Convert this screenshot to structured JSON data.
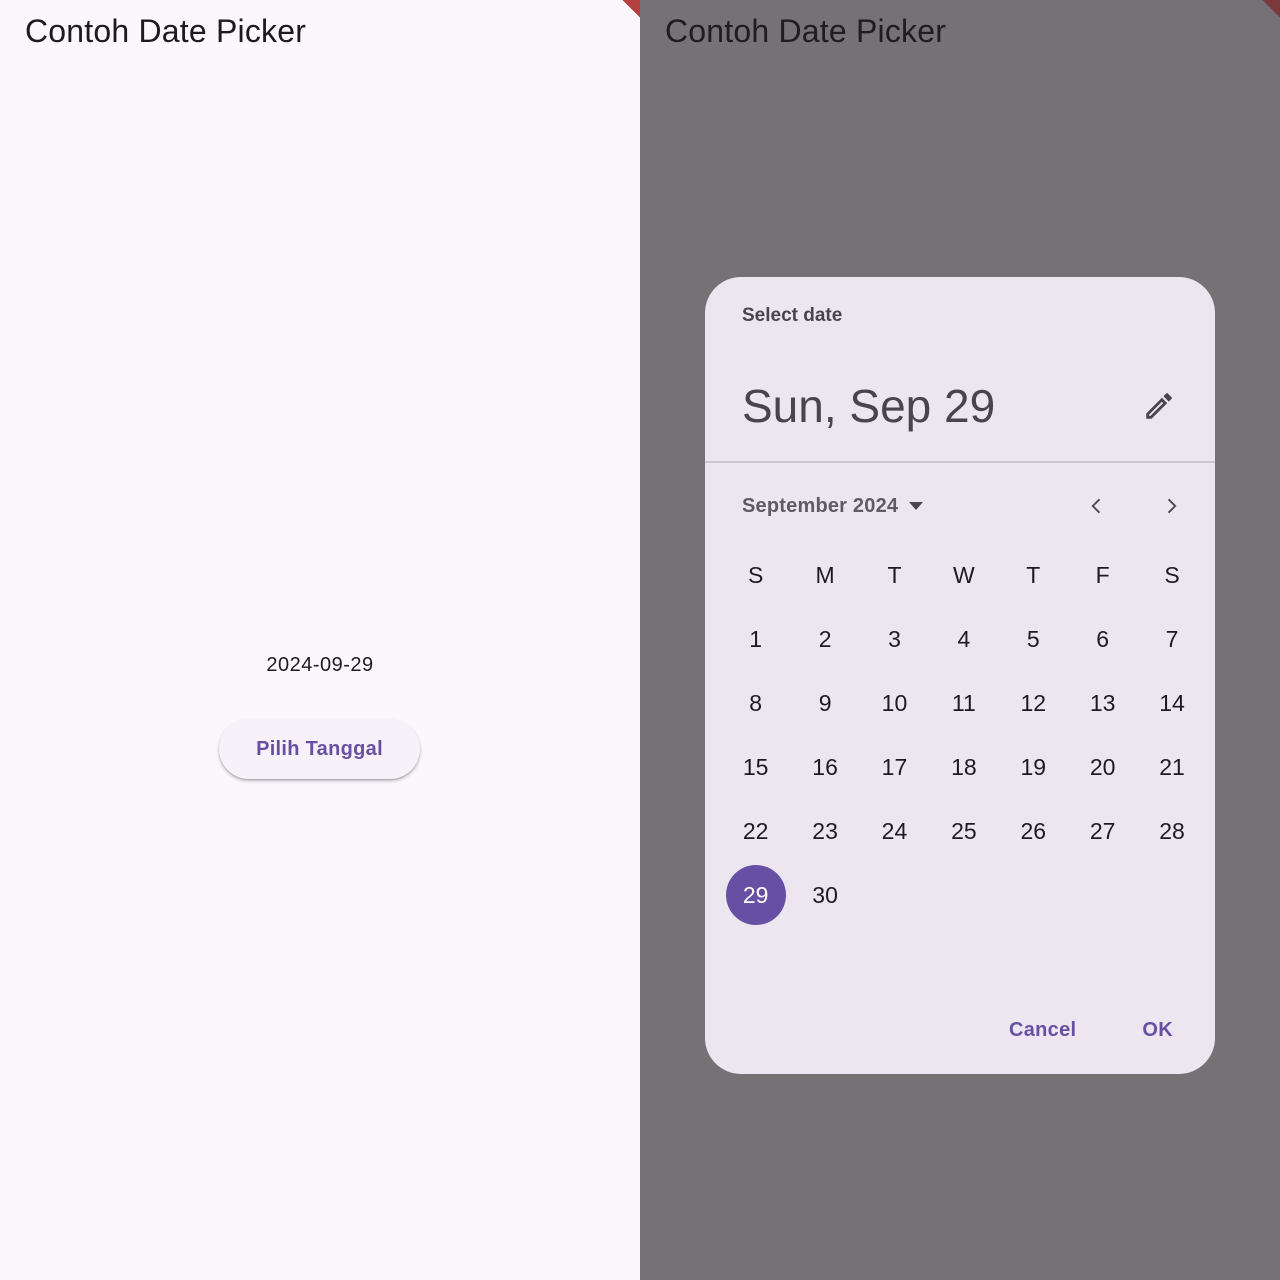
{
  "left_screen": {
    "app_title": "Contoh Date Picker",
    "selected_date_text": "2024-09-29",
    "pick_button_label": "Pilih Tanggal"
  },
  "right_screen": {
    "app_title": "Contoh Date Picker",
    "dialog": {
      "label": "Select date",
      "headline": "Sun, Sep 29",
      "edit_icon": "pencil-icon",
      "month_year": "September 2024",
      "dropdown_icon": "caret-down-icon",
      "prev_icon": "chevron-left-icon",
      "next_icon": "chevron-right-icon",
      "weekdays": [
        "S",
        "M",
        "T",
        "W",
        "T",
        "F",
        "S"
      ],
      "first_weekday_offset": 0,
      "days": [
        "1",
        "2",
        "3",
        "4",
        "5",
        "6",
        "7",
        "8",
        "9",
        "10",
        "11",
        "12",
        "13",
        "14",
        "15",
        "16",
        "17",
        "18",
        "19",
        "20",
        "21",
        "22",
        "23",
        "24",
        "25",
        "26",
        "27",
        "28",
        "29",
        "30"
      ],
      "selected_day": "29",
      "cancel_label": "Cancel",
      "ok_label": "OK"
    }
  },
  "colors": {
    "primary": "#6750a4",
    "surface": "#fcf6fd",
    "dialog_surface": "#ece6f0",
    "scrim": "#757175",
    "debug_banner": "#b4403f"
  }
}
